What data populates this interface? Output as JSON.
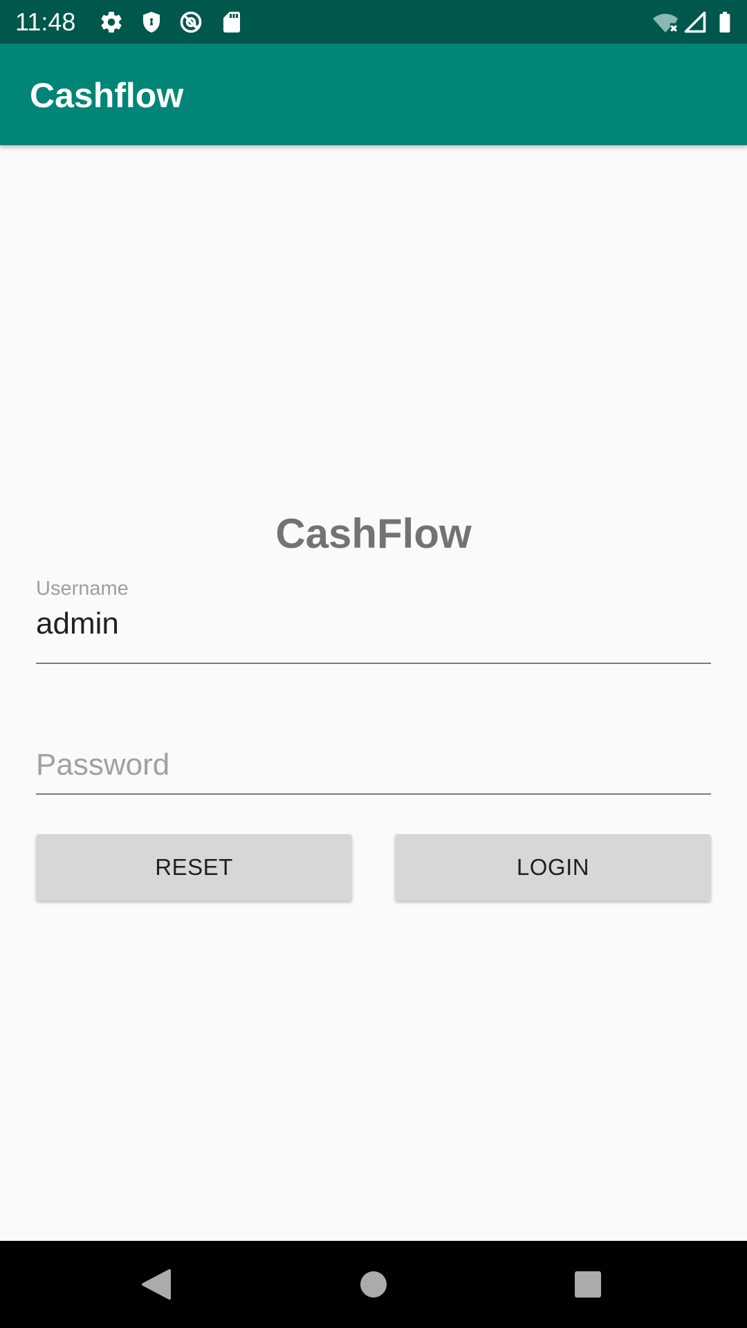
{
  "status_bar": {
    "time": "11:48",
    "icons": [
      "gear-icon",
      "shield-icon",
      "at-sign-icon",
      "sd-card-icon",
      "wifi-off-icon",
      "cell-signal-icon",
      "battery-icon"
    ]
  },
  "app_bar": {
    "title": "Cashflow"
  },
  "login": {
    "heading": "CashFlow",
    "username": {
      "label": "Username",
      "value": "admin"
    },
    "password": {
      "placeholder": "Password",
      "value": ""
    },
    "reset_label": "RESET",
    "login_label": "LOGIN"
  },
  "nav_bar": {
    "icons": [
      "back-icon",
      "home-icon",
      "recents-icon"
    ]
  },
  "colors": {
    "status_bar": "#00574b",
    "app_bar": "#008577",
    "background": "#fafafa",
    "button": "#d6d7d7",
    "heading": "#737373"
  }
}
